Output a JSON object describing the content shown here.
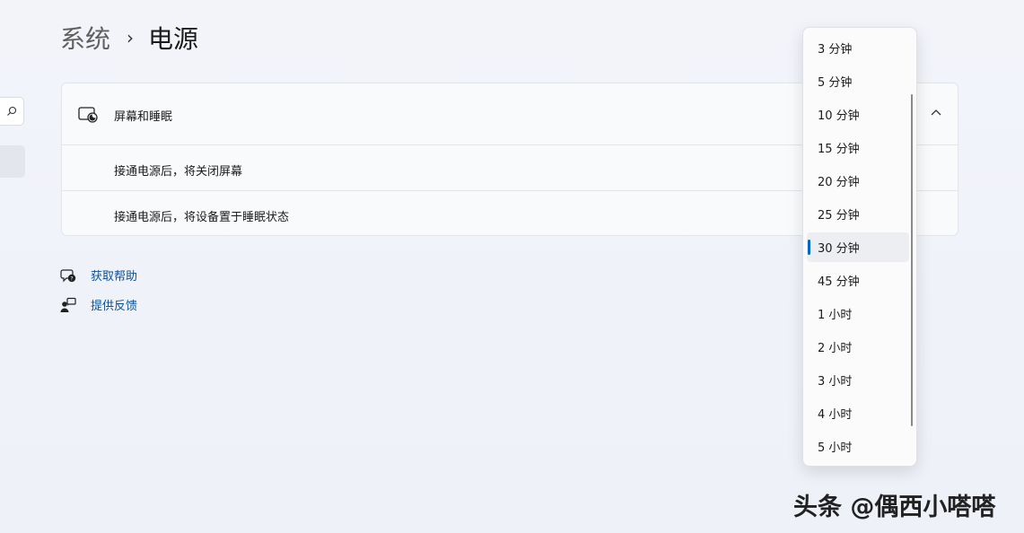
{
  "breadcrumb": {
    "parent": "系统",
    "separator": "›",
    "current": "电源"
  },
  "card": {
    "title": "屏幕和睡眠",
    "rows": [
      "接通电源后，将关闭屏幕",
      "接通电源后，将设备置于睡眠状态"
    ]
  },
  "links": [
    {
      "label": "获取帮助",
      "icon": "help-chat-icon"
    },
    {
      "label": "提供反馈",
      "icon": "feedback-icon"
    }
  ],
  "dropdown": {
    "options": [
      "3 分钟",
      "5 分钟",
      "10 分钟",
      "15 分钟",
      "20 分钟",
      "25 分钟",
      "30 分钟",
      "45 分钟",
      "1 小时",
      "2 小时",
      "3 小时",
      "4 小时",
      "5 小时"
    ],
    "selected": "30 分钟"
  },
  "watermark": "头条 @偶西小嗒嗒",
  "colors": {
    "accent": "#0067c0",
    "link": "#0b5096"
  }
}
